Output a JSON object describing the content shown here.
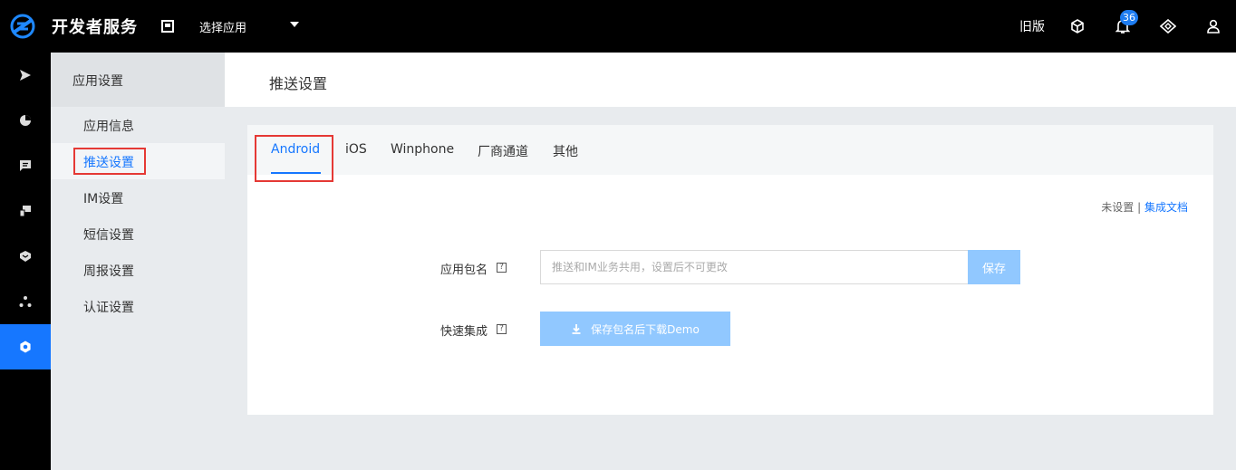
{
  "topbar": {
    "brand": "开发者服务",
    "app_select": "选择应用",
    "old_version": "旧版",
    "notification_count": "36",
    "icons": [
      "cube-icon",
      "bell-icon",
      "diamond-icon",
      "user-icon"
    ]
  },
  "rail": {
    "icons": [
      "send-icon",
      "pie-chart-icon",
      "message-icon",
      "devices-icon",
      "shield-icon",
      "nodes-icon",
      "settings-icon"
    ],
    "active_index": 6
  },
  "sidebar": {
    "title": "应用设置",
    "items": [
      {
        "label": "应用信息"
      },
      {
        "label": "推送设置"
      },
      {
        "label": "IM设置"
      },
      {
        "label": "短信设置"
      },
      {
        "label": "周报设置"
      },
      {
        "label": "认证设置"
      }
    ]
  },
  "page": {
    "title": "推送设置"
  },
  "tabs": [
    {
      "label": "Android"
    },
    {
      "label": "iOS"
    },
    {
      "label": "Winphone"
    },
    {
      "label": "厂商通道"
    },
    {
      "label": "其他"
    }
  ],
  "status": {
    "state": "未设置",
    "separator": "|",
    "doc_link": "集成文档"
  },
  "form": {
    "package_label": "应用包名",
    "package_placeholder": "推送和IM业务共用，设置后不可更改",
    "package_value": "",
    "save_label": "保存",
    "quick_label": "快速集成",
    "demo_label": "保存包名后下载Demo",
    "help_glyph": "?"
  },
  "colors": {
    "accent": "#1677ff",
    "disabled_button": "#91c8ff",
    "highlight": "#e53935",
    "topbar_bg": "#000000"
  }
}
